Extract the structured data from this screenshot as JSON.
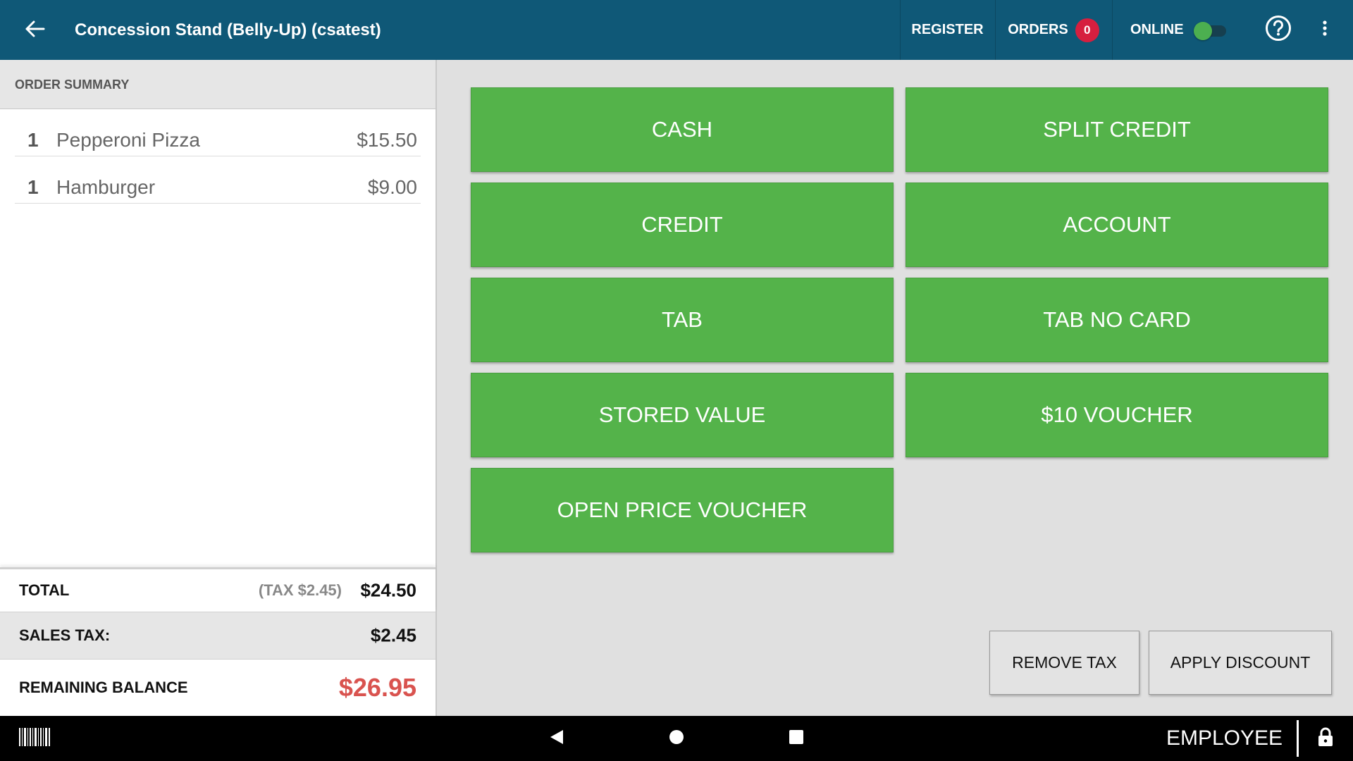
{
  "header": {
    "title": "Concession Stand (Belly-Up) (csatest)",
    "register_label": "REGISTER",
    "orders_label": "ORDERS",
    "orders_count": "0",
    "online_label": "ONLINE",
    "online_toggle_on": true,
    "icons": [
      "back-arrow-icon",
      "help-icon",
      "more-vert-icon"
    ]
  },
  "order_summary": {
    "heading": "ORDER SUMMARY",
    "items": [
      {
        "qty": "1",
        "name": "Pepperoni Pizza",
        "price": "$15.50"
      },
      {
        "qty": "1",
        "name": "Hamburger",
        "price": "$9.00"
      }
    ],
    "total_label": "TOTAL",
    "total_tax_note": "(TAX  $2.45)",
    "total_value": "$24.50",
    "sales_tax_label": "SALES TAX:",
    "sales_tax_value": "$2.45",
    "remaining_label": "REMAINING BALANCE",
    "remaining_value": "$26.95"
  },
  "payment_buttons": [
    "CASH",
    "SPLIT CREDIT",
    "CREDIT",
    "ACCOUNT",
    "TAB",
    "TAB NO CARD",
    "STORED VALUE",
    "$10 VOUCHER",
    "OPEN PRICE VOUCHER"
  ],
  "actions": {
    "remove_tax": "REMOVE TAX",
    "apply_discount": "APPLY DISCOUNT"
  },
  "navbar": {
    "employee_label": "EMPLOYEE",
    "icons": [
      "barcode-icon",
      "nav-back-icon",
      "nav-home-icon",
      "nav-recents-icon",
      "lock-icon"
    ]
  },
  "colors": {
    "appbar": "#0f5877",
    "pay_button": "#54b34a",
    "badge": "#d61f3f",
    "balance_red": "#d9534f"
  }
}
